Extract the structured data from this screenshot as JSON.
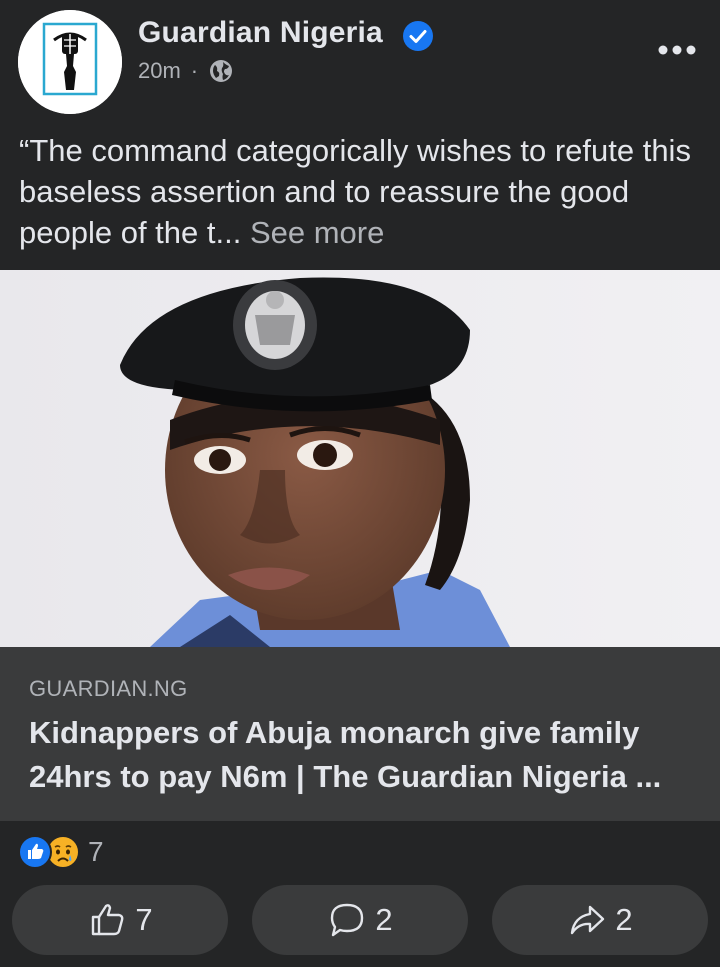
{
  "post": {
    "page_name": "Guardian Nigeria",
    "time": "20m",
    "separator": "·",
    "caption": "“The command categorically wishes to refute this baseless assertion and to reassure the good people of the t...",
    "see_more": "See more",
    "privacy_icon": "globe-icon",
    "verified_icon": "verified-badge-icon"
  },
  "link": {
    "domain": "GUARDIAN.NG",
    "headline": "Kidnappers of Abuja monarch give family 24hrs to pay N6m | The Guardian Nigeria ..."
  },
  "reactions": {
    "types": [
      "like",
      "sad"
    ],
    "count": "7"
  },
  "actions": {
    "like_count": "7",
    "comment_count": "2",
    "share_count": "2"
  },
  "colors": {
    "background": "#242526",
    "surface": "#3a3b3c",
    "text_primary": "#e4e6eb",
    "text_secondary": "#b0b3b8",
    "accent_blue": "#1877f2"
  }
}
